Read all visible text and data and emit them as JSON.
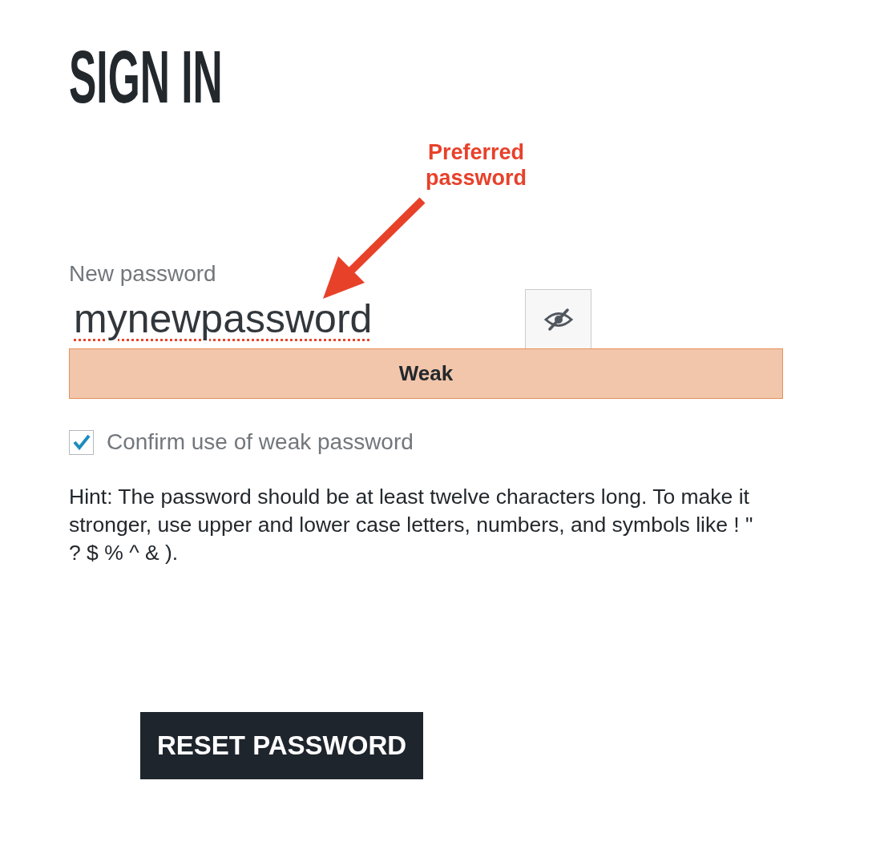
{
  "heading": "SIGN IN",
  "annotation": {
    "text": "Preferred password"
  },
  "password_field": {
    "label": "New password",
    "value": "mynewpassword",
    "misspelled": true,
    "visible": true
  },
  "strength": {
    "label": "Weak",
    "kind": "weak"
  },
  "confirm": {
    "label": "Confirm use of weak password",
    "checked": true
  },
  "hint": "Hint: The password should be at least twelve characters long. To make it stronger, use upper and lower case letters, numbers, and symbols like ! \" ? $ % ^ & ).",
  "submit": {
    "label": "RESET PASSWORD"
  }
}
